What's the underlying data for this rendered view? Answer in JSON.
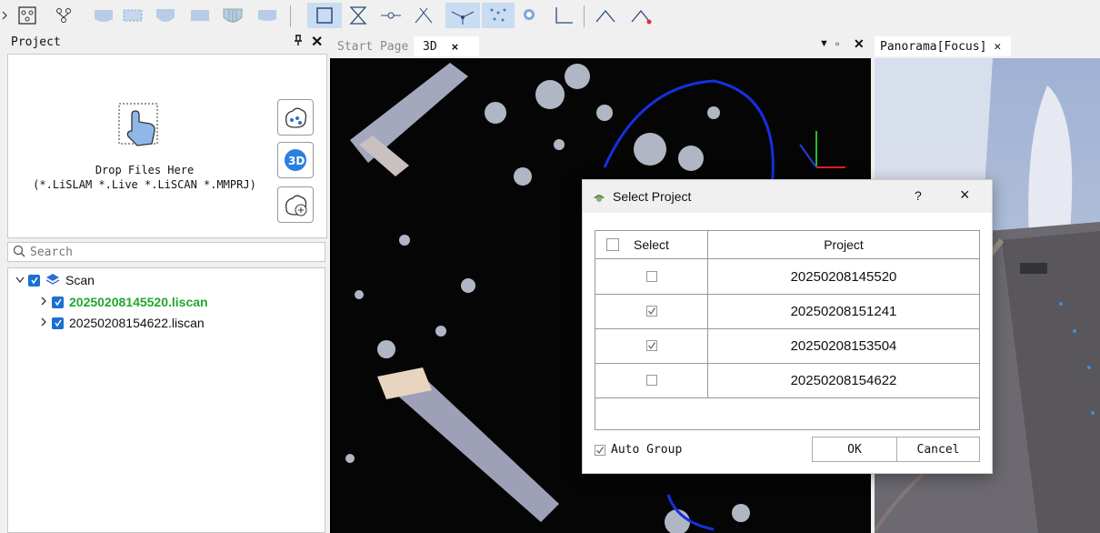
{
  "toolbar": {
    "tools": [
      "chevron-right-icon",
      "topology-icon",
      "tree-split-icon",
      "shape-1-icon",
      "shape-2-icon",
      "shape-3-icon",
      "shape-4-icon",
      "shape-5-icon",
      "shape-6-icon",
      "select-box-icon",
      "hourglass-icon",
      "pin-line-icon",
      "intersect-icon",
      "fork-icon",
      "scatter-icon",
      "cluster-icon",
      "angle-icon",
      "peak-icon",
      "peak-edit-icon"
    ]
  },
  "project_panel": {
    "title": "Project",
    "pin_icon": "pin-icon",
    "close_icon": "close-icon",
    "drop_line1": "Drop Files Here",
    "drop_line2": "(*.LiSLAM *.Live *.LiSCAN *.MMPRJ)",
    "search_placeholder": "Search",
    "tree": {
      "root_label": "Scan",
      "items": [
        {
          "label": "20250208145520.liscan",
          "highlight": true
        },
        {
          "label": "20250208154622.liscan",
          "highlight": false
        }
      ]
    }
  },
  "view3d": {
    "tabs": [
      {
        "label": "Start Page"
      },
      {
        "label": "3D"
      }
    ],
    "tab_close": "×"
  },
  "panorama": {
    "tab_label": "Panorama[Focus]"
  },
  "dialog": {
    "title": "Select Project",
    "help": "?",
    "close": "×",
    "columns": [
      "Select",
      "Project"
    ],
    "rows": [
      {
        "project": "20250208145520",
        "checked": false
      },
      {
        "project": "20250208151241",
        "checked": true
      },
      {
        "project": "20250208153504",
        "checked": true
      },
      {
        "project": "20250208154622",
        "checked": false
      }
    ],
    "auto_group_label": "Auto Group",
    "auto_group_checked": true,
    "ok_label": "OK",
    "cancel_label": "Cancel"
  },
  "colors": {
    "accent": "#1b6fd0",
    "highlight_text": "#1fa82d",
    "toolbar_active": "#c9dcf2"
  }
}
